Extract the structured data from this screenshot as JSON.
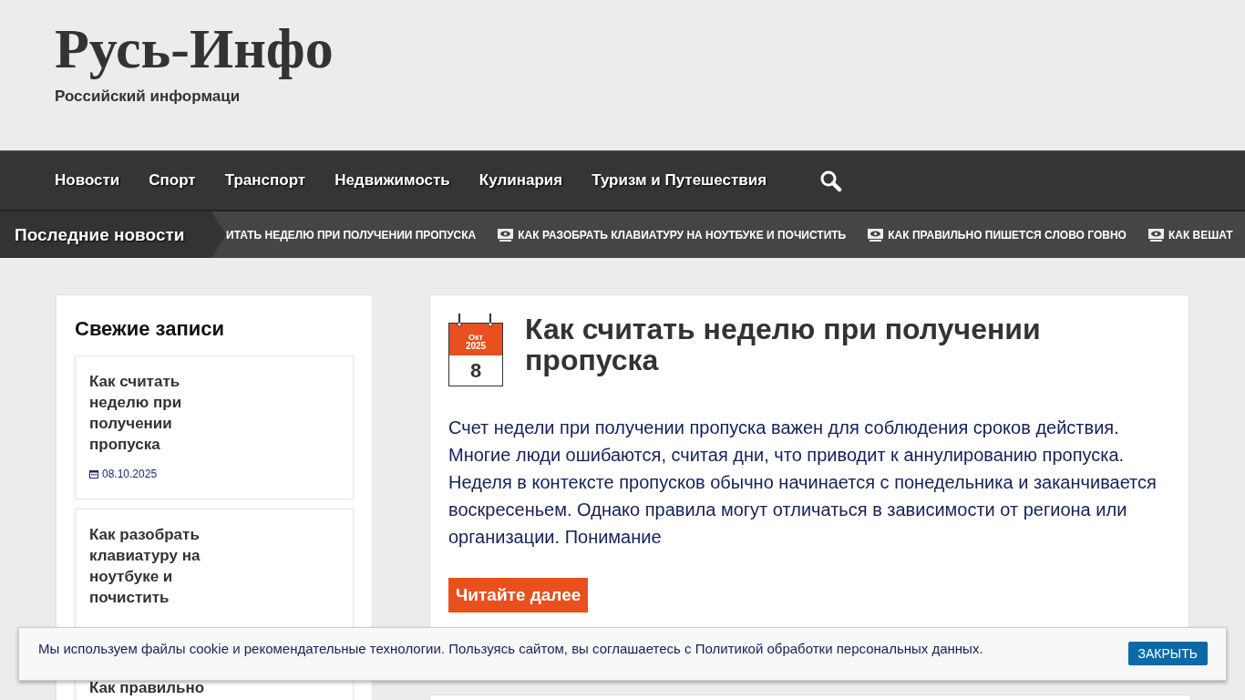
{
  "site": {
    "title": "Русь-Инфо",
    "tagline": "Российский информаци"
  },
  "nav": {
    "items": [
      "Новости",
      "Спорт",
      "Транспорт",
      "Недвижимость",
      "Кулинария",
      "Туризм и Путешествия"
    ]
  },
  "ticker": {
    "label": "Последние новости",
    "items": [
      {
        "text": "ИТАТЬ НЕДЕЛЮ ПРИ ПОЛУЧЕНИИ ПРОПУСКА",
        "icon": false
      },
      {
        "text": "КАК РАЗОБРАТЬ КЛАВИАТУРУ НА НОУТБУКЕ И ПОЧИСТИТЬ",
        "icon": true
      },
      {
        "text": "КАК ПРАВИЛЬНО ПИШЕТСЯ СЛОВО ГОВНО",
        "icon": true
      },
      {
        "text": "КАК ВЕШАТ",
        "icon": true
      }
    ]
  },
  "sidebar": {
    "title": "Свежие записи",
    "posts": [
      {
        "title": "Как считать неделю при получении пропуска",
        "date": "08.10.2025"
      },
      {
        "title": "Как разобрать клавиатуру на ноутбуке и почистить"
      },
      {
        "title": "Как правильно"
      }
    ]
  },
  "article": {
    "month": "Окт",
    "year": "2025",
    "day": "8",
    "title": "Как считать неделю при получении пропуска",
    "excerpt": "Счет недели при получении пропуска важен для соблюдения сроков действия. Многие люди ошибаются, считая дни, что приводит к аннулированию пропуска. Неделя в контексте пропусков обычно начинается с понедельника и заканчивается воскресеньем. Однако правила могут отличаться в зависимости от региона или организации. Понимание",
    "read_more": "Читайте далее"
  },
  "cookie": {
    "text": "Мы используем файлы cookie и рекомендательные технологии. Пользуясь сайтом, вы соглашаетесь с Политикой обработки персональных данных.",
    "button": "ЗАКРЫТЬ"
  }
}
